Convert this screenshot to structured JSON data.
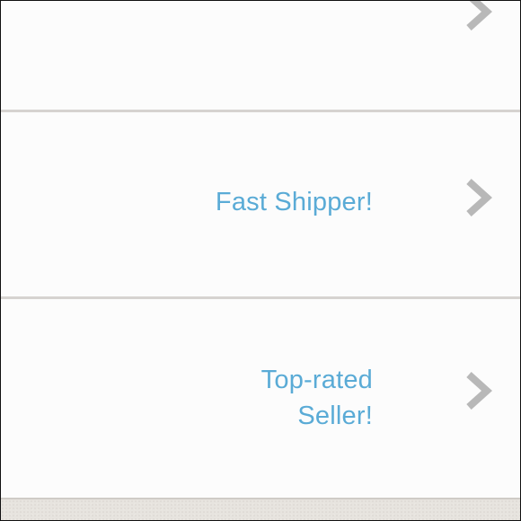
{
  "rows": [
    {
      "label_lines": []
    },
    {
      "label_lines": [
        "Fast Shipper!"
      ]
    },
    {
      "label_lines": [
        "Top-rated",
        "Seller!"
      ]
    }
  ],
  "icons": {
    "row_chevron": "chevron-right-icon"
  },
  "colors": {
    "label": "#5aabd6",
    "chevron": "#b8b8b8",
    "divider": "#d6d3d0",
    "background": "#fcfcfc"
  }
}
